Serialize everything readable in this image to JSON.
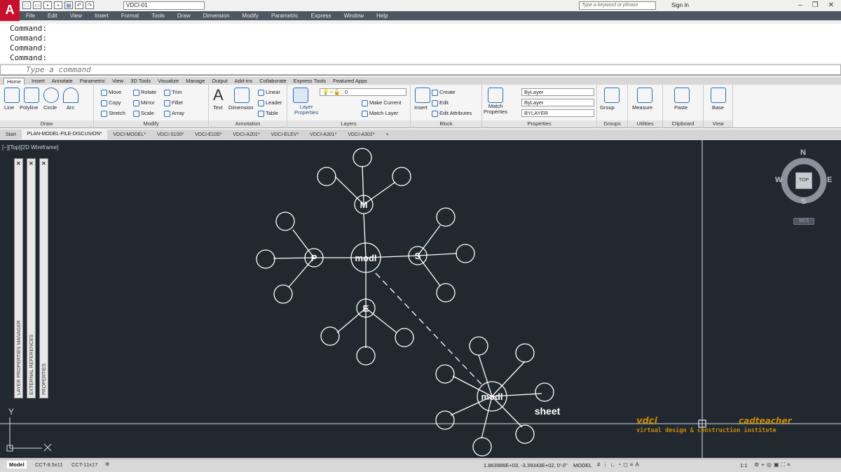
{
  "app": {
    "logo_letter": "A",
    "workspace": "VDCI-01",
    "search_placeholder": "Type a keyword or phrase",
    "sign_in": "Sign In"
  },
  "menu": [
    "File",
    "Edit",
    "View",
    "Insert",
    "Format",
    "Tools",
    "Draw",
    "Dimension",
    "Modify",
    "Parametric",
    "Express",
    "Window",
    "Help"
  ],
  "command_window": {
    "lines": [
      "Command:",
      "Command:",
      "Command:",
      "Command:"
    ],
    "placeholder": "Type a command"
  },
  "ribbon_tabs": [
    "Home",
    "Insert",
    "Annotate",
    "Parametric",
    "View",
    "3D Tools",
    "Visualize",
    "Manage",
    "Output",
    "Add-ins",
    "Collaborate",
    "Express Tools",
    "Featured Apps"
  ],
  "ribbon": {
    "draw": {
      "title": "Draw",
      "line": "Line",
      "polyline": "Polyline",
      "circle": "Circle",
      "arc": "Arc"
    },
    "modify": {
      "title": "Modify",
      "move": "Move",
      "rotate": "Rotate",
      "trim": "Trim",
      "copy": "Copy",
      "mirror": "Mirror",
      "fillet": "Fillet",
      "stretch": "Stretch",
      "scale": "Scale",
      "array": "Array"
    },
    "annotation": {
      "title": "Annotation",
      "text": "Text",
      "dimension": "Dimension",
      "linear": "Linear",
      "leader": "Leader",
      "table": "Table"
    },
    "layers": {
      "title": "Layers",
      "layer_properties_1": "Layer",
      "layer_properties_2": "Properties",
      "current_layer": "0",
      "make_current": "Make Current",
      "match_layer": "Match Layer"
    },
    "block": {
      "title": "Block",
      "insert": "Insert",
      "create": "Create",
      "edit": "Edit",
      "edit_attributes": "Edit Attributes"
    },
    "properties": {
      "title": "Properties",
      "match_1": "Match",
      "match_2": "Properties",
      "color": "ByLayer",
      "linetype": "ByLayer",
      "lineweight": "BYLAYER"
    },
    "groups": {
      "title": "Groups",
      "group": "Group"
    },
    "utilities": {
      "title": "Utilities",
      "measure": "Measure"
    },
    "clipboard": {
      "title": "Clipboard",
      "paste": "Paste"
    },
    "view": {
      "title": "View",
      "base": "Base"
    }
  },
  "file_tabs": [
    "Start",
    "PLAN-MODEL-FILE-DISCUSION*",
    "VDCI-MODEL*",
    "VDCI-S100*",
    "VDCI-E100*",
    "VDCI-A201*",
    "VDCI-ELEV*",
    "VDCI-A301*",
    "VDCI-A302*"
  ],
  "viewport_label": "[−][Top][2D Wireframe]",
  "palettes": [
    "LAYER PROPERTIES MANAGER",
    "EXTERNAL REFERENCES",
    "PROPERTIES"
  ],
  "viewcube": {
    "n": "N",
    "s": "S",
    "e": "E",
    "w": "W",
    "face": "TOP",
    "wcs": "WCS"
  },
  "drawing": {
    "center_label": "modl",
    "m": "M",
    "p": "P",
    "s": "S",
    "e": "E",
    "lower_center": "modl",
    "sheet": "sheet"
  },
  "watermark": {
    "vdci": "vdci",
    "cadteacher": "cadteacher",
    "tagline": "virtual design & construction institute"
  },
  "axis": {
    "y": "Y",
    "x": "X"
  },
  "layout_tabs": [
    "Model",
    "CCT-8.5x11",
    "CCT-11x17"
  ],
  "status": {
    "coords": "1.863986E+03, -3.39343E+02, 0'-0\"",
    "mode": "MODEL",
    "scale": "1:1"
  },
  "colors": {
    "canvas": "#212830",
    "drawing_lines": "#ffffff",
    "accent": "#c98b00",
    "menu": "#4e5761"
  }
}
